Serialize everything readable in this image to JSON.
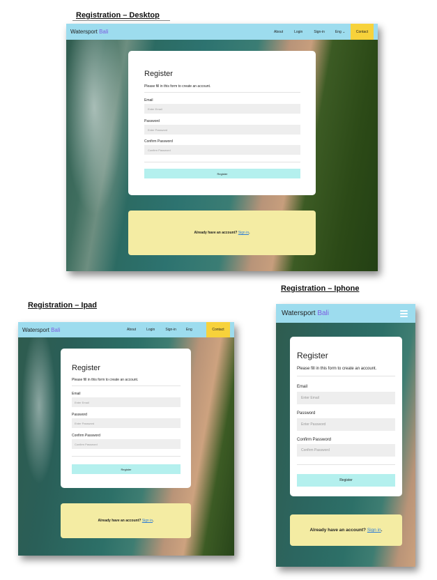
{
  "titles": {
    "desktop": "Registration – Desktop",
    "ipad": "Registration – Ipad",
    "iphone": "Registration – Iphone"
  },
  "brand": {
    "name": "Watersport",
    "accent": "Bali"
  },
  "nav": {
    "about": "About",
    "login": "Login",
    "signin": "Sign-in",
    "lang": "Eng",
    "lang_caret": "⌄",
    "contact": "Contact"
  },
  "form": {
    "heading": "Register",
    "subtitle": "Please fill in this form to create an account.",
    "email_label": "Email",
    "email_placeholder": "Enter Email",
    "password_label": "Password",
    "password_placeholder": "Enter Password",
    "confirm_label": "Confirm Password",
    "confirm_placeholder": "Confirm Password",
    "register_button": "Register"
  },
  "signin_prompt": {
    "text": "Already have an account?",
    "link": "Sign in",
    "suffix": "."
  },
  "icons": {
    "menu": "hamburger-menu-icon"
  },
  "colors": {
    "navbar": "#9ddcee",
    "contact": "#f7d23b",
    "brand_accent": "#7b5ce0",
    "register_button": "#b4f0ee",
    "signin_box": "#f4eca3",
    "link": "#2a7ad6"
  }
}
